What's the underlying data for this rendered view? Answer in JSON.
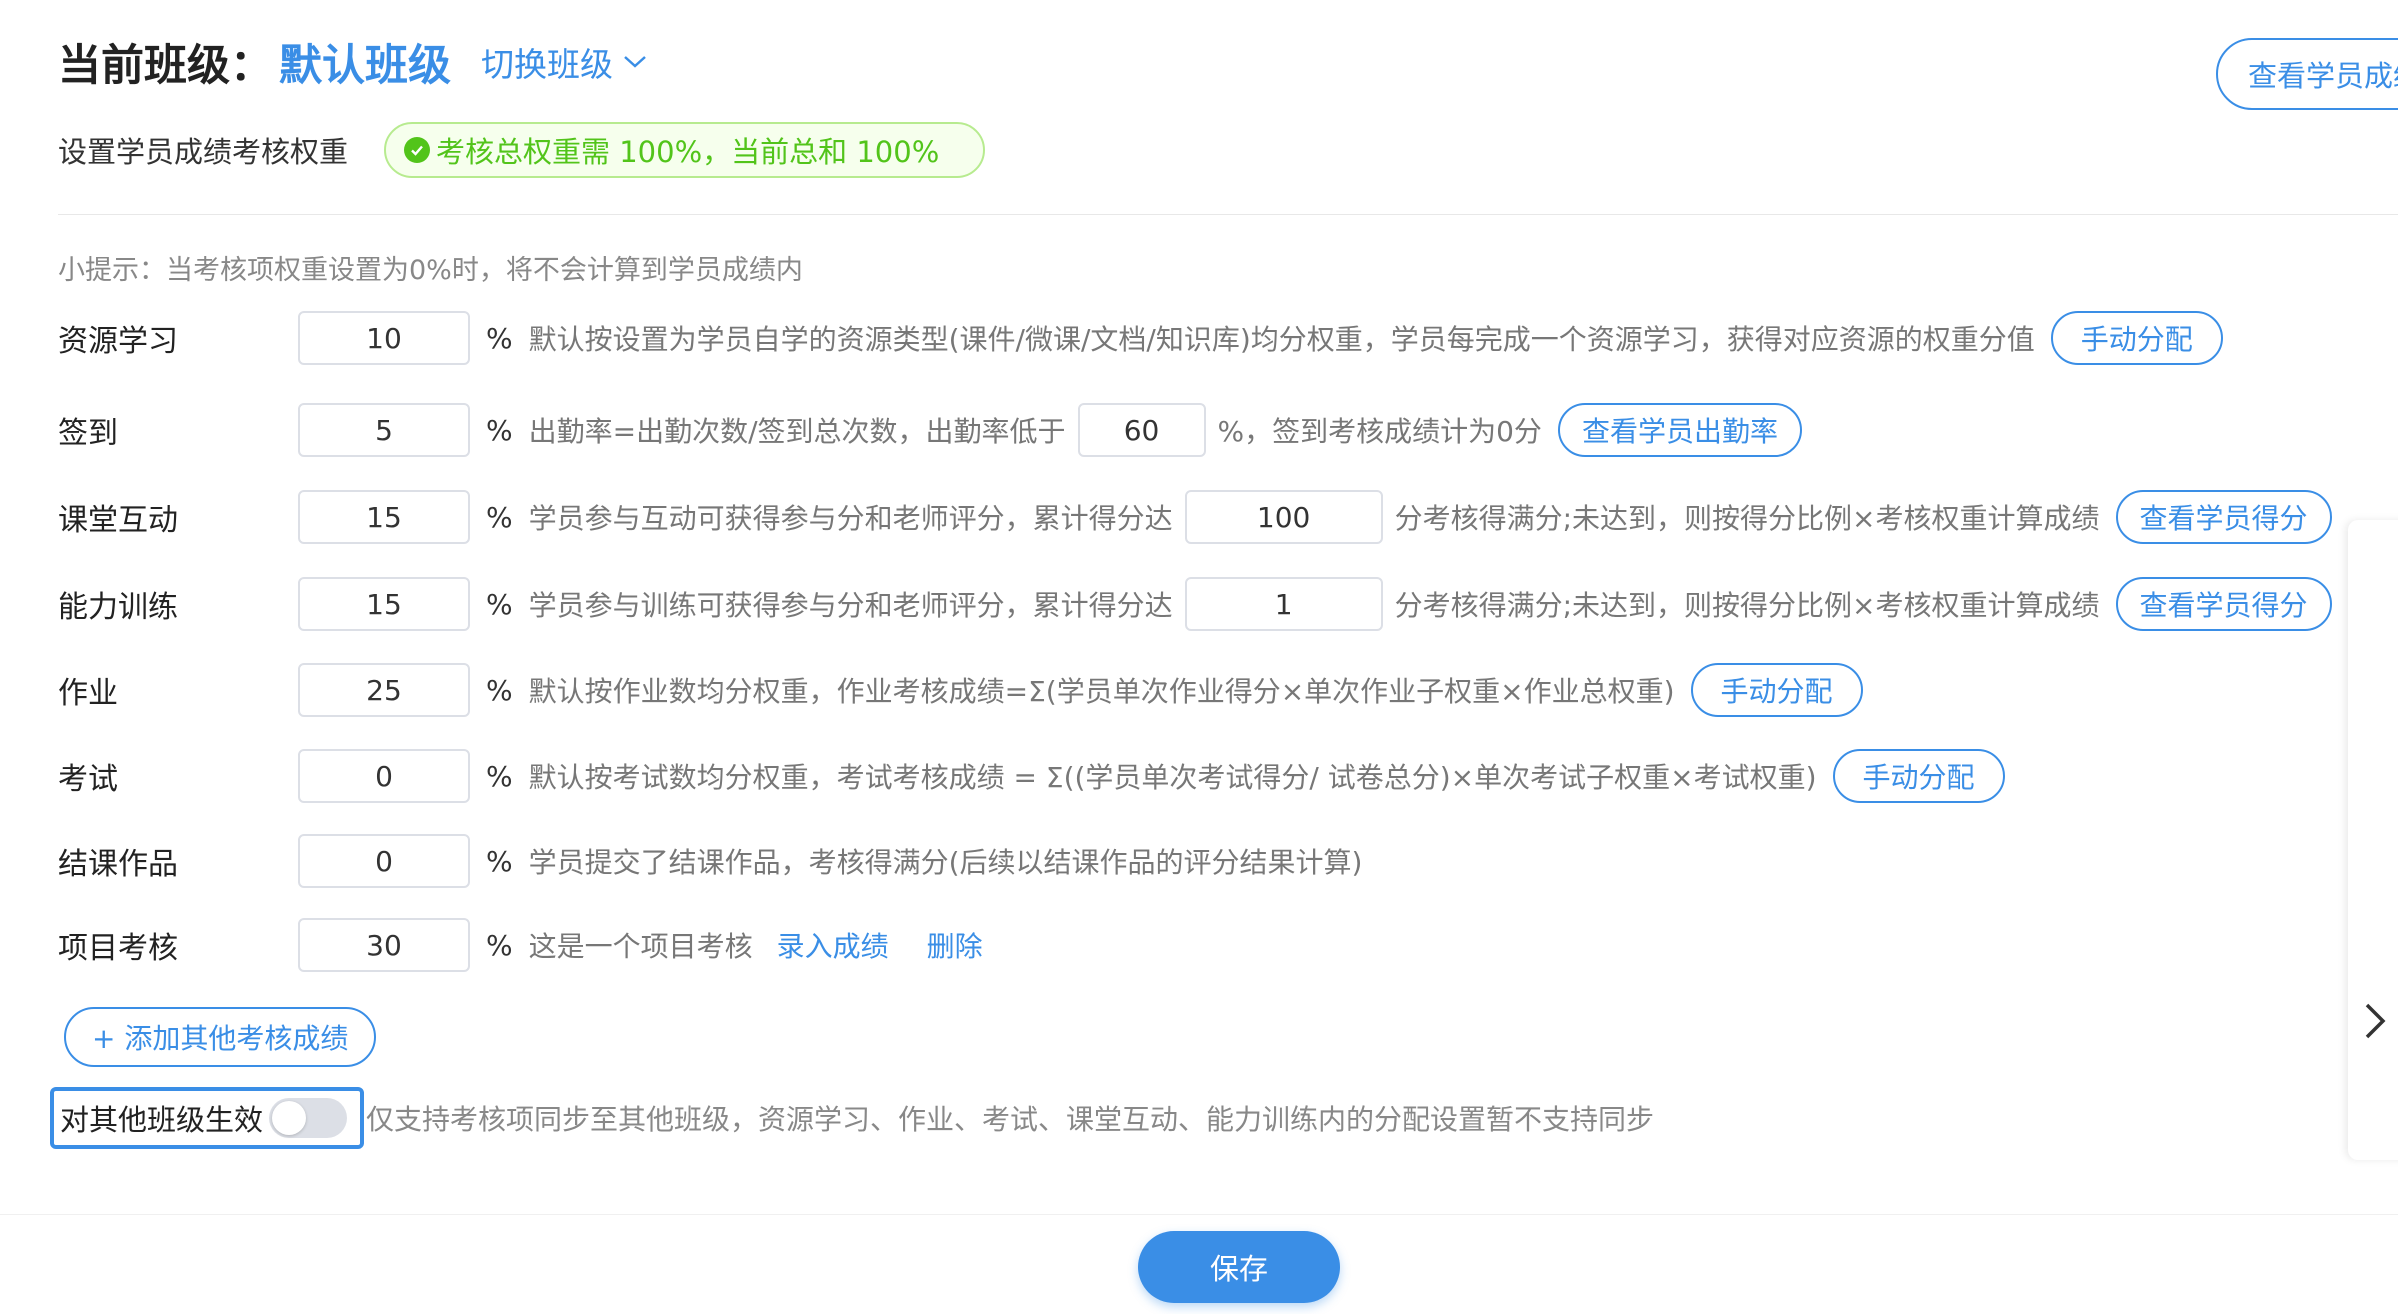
{
  "header": {
    "current_label": "当前班级：",
    "current_class": "默认班级",
    "switch_label": "切换班级",
    "view_scores_label": "查看学员成绩"
  },
  "weights": {
    "label": "设置学员成绩考核权重",
    "status": "考核总权重需 100%，当前总和 100%"
  },
  "tip": "小提示：当考核项权重设置为0%时，将不会计算到学员成绩内",
  "rows": {
    "resource": {
      "label": "资源学习",
      "value": "10",
      "pct": "%",
      "desc": "默认按设置为学员自学的资源类型(课件/微课/文档/知识库)均分权重，学员每完成一个资源学习，获得对应资源的权重分值",
      "button": "手动分配"
    },
    "signin": {
      "label": "签到",
      "value": "5",
      "pct": "%",
      "desc1": "出勤率=出勤次数/签到总次数，出勤率低于",
      "threshold": "60",
      "desc2": "%，签到考核成绩计为0分",
      "button": "查看学员出勤率"
    },
    "interaction": {
      "label": "课堂互动",
      "value": "15",
      "pct": "%",
      "desc1": "学员参与互动可获得参与分和老师评分，累计得分达",
      "threshold": "100",
      "desc2": "分考核得满分;未达到，则按得分比例×考核权重计算成绩",
      "button": "查看学员得分"
    },
    "training": {
      "label": "能力训练",
      "value": "15",
      "pct": "%",
      "desc1": "学员参与训练可获得参与分和老师评分，累计得分达",
      "threshold": "1",
      "desc2": "分考核得满分;未达到，则按得分比例×考核权重计算成绩",
      "button": "查看学员得分"
    },
    "homework": {
      "label": "作业",
      "value": "25",
      "pct": "%",
      "desc": "默认按作业数均分权重，作业考核成绩=Σ(学员单次作业得分×单次作业子权重×作业总权重)",
      "button": "手动分配"
    },
    "exam": {
      "label": "考试",
      "value": "0",
      "pct": "%",
      "desc": "默认按考试数均分权重，考试考核成绩 = Σ((学员单次考试得分/ 试卷总分)×单次考试子权重×考试权重)",
      "button": "手动分配"
    },
    "final_work": {
      "label": "结课作品",
      "value": "0",
      "pct": "%",
      "desc": "学员提交了结课作品，考核得满分(后续以结课作品的评分结果计算)"
    },
    "project": {
      "label": "项目考核",
      "value": "30",
      "pct": "%",
      "desc": "这是一个项目考核",
      "link1": "录入成绩",
      "link2": "删除"
    }
  },
  "add_button": "+ 添加其他考核成绩",
  "sync": {
    "label": "对其他班级生效",
    "enabled": false,
    "note": "仅支持考核项同步至其他班级，资源学习、作业、考试、课堂互动、能力训练内的分配设置暂不支持同步"
  },
  "save_button": "保存",
  "colors": {
    "primary": "#3a8ee6",
    "success": "#52c41a",
    "success_bg": "#f6ffed"
  }
}
